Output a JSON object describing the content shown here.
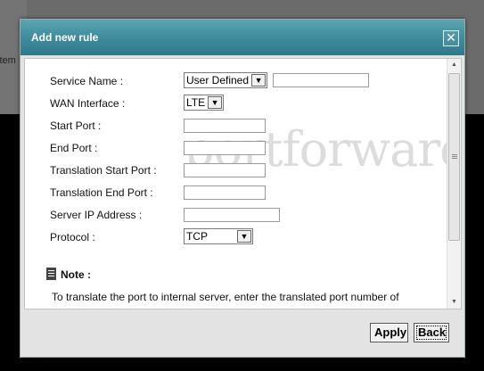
{
  "background": {
    "partial_text": "stem"
  },
  "dialog": {
    "title": "Add new rule",
    "close_glyph": "✕",
    "watermark": "portforward"
  },
  "form": {
    "service_name": {
      "label": "Service Name :",
      "selected": "User Defined",
      "value": ""
    },
    "wan_interface": {
      "label": "WAN Interface :",
      "selected": "LTE"
    },
    "start_port": {
      "label": "Start Port :",
      "value": ""
    },
    "end_port": {
      "label": "End Port :",
      "value": ""
    },
    "translation_start_port": {
      "label": "Translation Start Port :",
      "value": ""
    },
    "translation_end_port": {
      "label": "Translation End Port :",
      "value": ""
    },
    "server_ip": {
      "label": "Server IP Address :",
      "value": ""
    },
    "protocol": {
      "label": "Protocol :",
      "selected": "TCP"
    }
  },
  "note": {
    "heading": "Note :",
    "text": "To translate the port to internal server, enter the translated port number of"
  },
  "footer": {
    "apply_label": "Apply",
    "back_label": "Back"
  },
  "colors": {
    "titlebar": "#3f8c9c",
    "panel": "#ffffff",
    "dialog_bg": "#e3e3e3"
  },
  "icons": {
    "close": "close-icon",
    "note": "note-icon",
    "dropdown": "chevron-down-icon"
  }
}
